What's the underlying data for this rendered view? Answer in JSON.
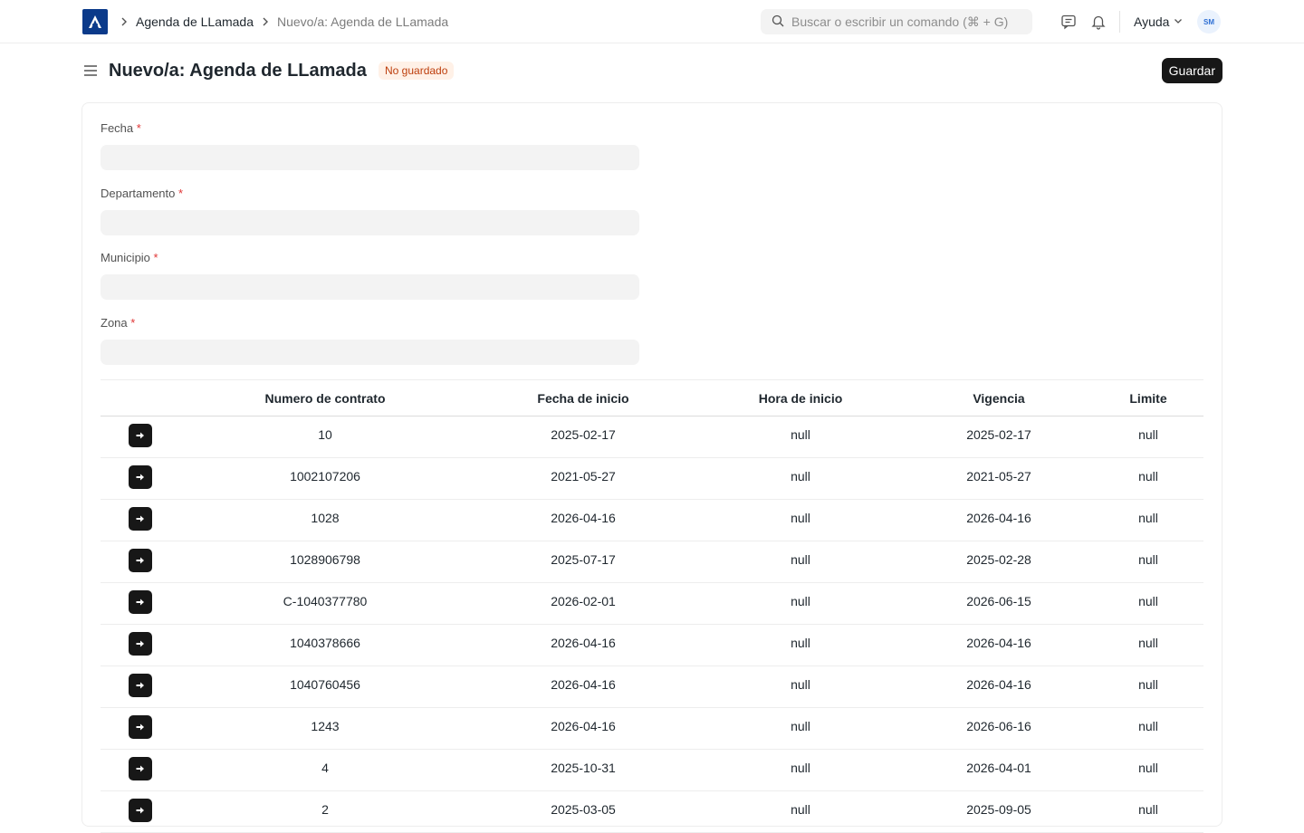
{
  "navbar": {
    "breadcrumbs": [
      "Agenda de LLamada",
      "Nuevo/a: Agenda de LLamada"
    ],
    "search_placeholder": "Buscar o escribir un comando (⌘ + G)",
    "help_label": "Ayuda",
    "avatar_initials": "SM"
  },
  "page": {
    "title": "Nuevo/a: Agenda de LLamada",
    "status": "No guardado",
    "save_label": "Guardar"
  },
  "form": {
    "fields": [
      {
        "label": "Fecha",
        "required": "*"
      },
      {
        "label": "Departamento",
        "required": "*"
      },
      {
        "label": "Municipio",
        "required": "*"
      },
      {
        "label": "Zona",
        "required": "*"
      }
    ]
  },
  "table": {
    "columns": [
      "Numero de contrato",
      "Fecha de inicio",
      "Hora de inicio",
      "Vigencia",
      "Limite"
    ],
    "rows": [
      [
        "10",
        "2025-02-17",
        "null",
        "2025-02-17",
        "null"
      ],
      [
        "1002107206",
        "2021-05-27",
        "null",
        "2021-05-27",
        "null"
      ],
      [
        "1028",
        "2026-04-16",
        "null",
        "2026-04-16",
        "null"
      ],
      [
        "1028906798",
        "2025-07-17",
        "null",
        "2025-02-28",
        "null"
      ],
      [
        "C-1040377780",
        "2026-02-01",
        "null",
        "2026-06-15",
        "null"
      ],
      [
        "1040378666",
        "2026-04-16",
        "null",
        "2026-04-16",
        "null"
      ],
      [
        "1040760456",
        "2026-04-16",
        "null",
        "2026-04-16",
        "null"
      ],
      [
        "1243",
        "2026-04-16",
        "null",
        "2026-06-16",
        "null"
      ],
      [
        "4",
        "2025-10-31",
        "null",
        "2026-04-01",
        "null"
      ],
      [
        "2",
        "2025-03-05",
        "null",
        "2025-09-05",
        "null"
      ]
    ]
  },
  "colors": {
    "brand": "#0b3a8a",
    "primary_button": "#171717",
    "badge_bg": "#fff1e7",
    "badge_text": "#bd3e0c",
    "required": "#e03636"
  },
  "icons": [
    "app-logo-icon",
    "chevron-right-icon",
    "search-icon",
    "chat-icon",
    "bell-icon",
    "chevron-down-icon",
    "hamburger-icon",
    "arrow-right-icon"
  ]
}
